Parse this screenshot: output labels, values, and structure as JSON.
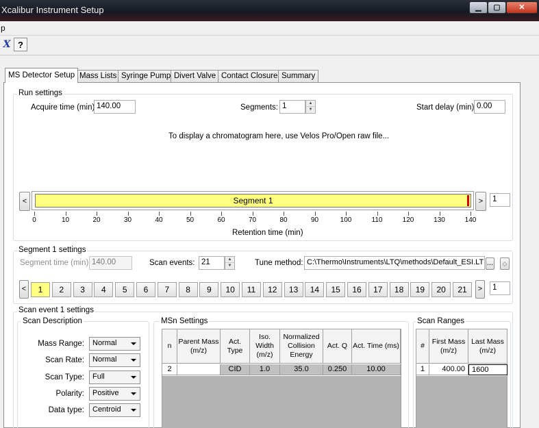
{
  "window": {
    "title": "Xcalibur Instrument Setup",
    "menu_partial": "p"
  },
  "toolbar": {
    "icons": [
      "close-x-icon",
      "help-question-icon"
    ]
  },
  "tabs": [
    "MS Detector Setup",
    "Mass Lists",
    "Syringe Pump",
    "Divert Valve",
    "Contact Closure",
    "Summary"
  ],
  "run": {
    "group": "Run settings",
    "acquire_label": "Acquire time (min):",
    "acquire_value": "140.00",
    "segments_label": "Segments:",
    "segments_value": "1",
    "delay_label": "Start delay (min):",
    "delay_value": "0.00",
    "message": "To display a chromatogram here, use Velos Pro/Open raw file...",
    "segment_label": "Segment 1",
    "segment_number": "1",
    "axis_ticks": [
      "0",
      "10",
      "20",
      "30",
      "40",
      "50",
      "60",
      "70",
      "80",
      "90",
      "100",
      "110",
      "120",
      "130",
      "140"
    ],
    "axis_label": "Retention time (min)"
  },
  "segment": {
    "group": "Segment 1 settings",
    "time_label": "Segment time (min):",
    "time_value": "140.00",
    "events_label": "Scan events:",
    "events_value": "21",
    "tune_label": "Tune method:",
    "tune_value": "C:\\Thermo\\Instruments\\LTQ\\methods\\Default_ESI.LT",
    "browse": "...",
    "events": [
      "1",
      "2",
      "3",
      "4",
      "5",
      "6",
      "7",
      "8",
      "9",
      "10",
      "11",
      "12",
      "13",
      "14",
      "15",
      "16",
      "17",
      "18",
      "19",
      "20",
      "21"
    ],
    "event_number": "1"
  },
  "scan": {
    "group": "Scan event 1 settings",
    "description": {
      "title": "Scan Description",
      "fields": [
        {
          "label": "Mass Range:",
          "value": "Normal"
        },
        {
          "label": "Scan Rate:",
          "value": "Normal"
        },
        {
          "label": "Scan Type:",
          "value": "Full"
        },
        {
          "label": "Polarity:",
          "value": "Positive"
        },
        {
          "label": "Data type:",
          "value": "Centroid"
        }
      ]
    },
    "msn": {
      "title": "MSn Settings",
      "headers": [
        "n",
        "Parent Mass (m/z)",
        "Act. Type",
        "Iso. Width (m/z)",
        "Normalized Collision Energy",
        "Act. Q",
        "Act. Time (ms)"
      ],
      "row": [
        "2",
        "",
        "CID",
        "1.0",
        "35.0",
        "0.250",
        "10.00"
      ]
    },
    "ranges": {
      "title": "Scan Ranges",
      "headers": [
        "#",
        "First Mass (m/z)",
        "Last Mass (m/z)"
      ],
      "row": [
        "1",
        "400.00",
        "1600"
      ]
    }
  },
  "colors": {
    "segment_fill": "#ffff80",
    "segment_marker": "#d40000",
    "active_event": "#ffff80"
  }
}
